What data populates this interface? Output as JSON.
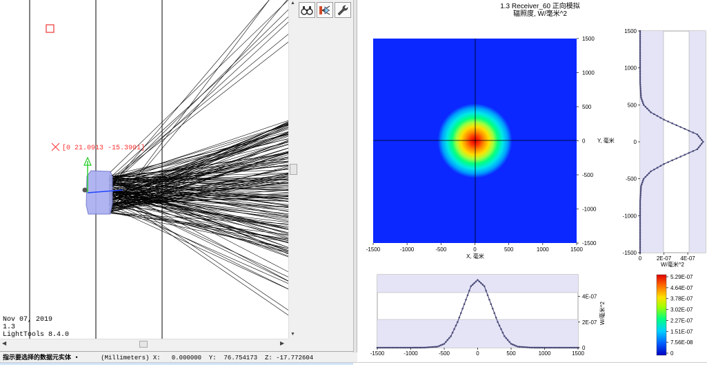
{
  "viewport": {
    "date": "Nov 07, 2019",
    "version": "1.3",
    "app": "LightTools 8.4.0",
    "coord_label": "[0 21.0913 -15.3901]"
  },
  "toolbar": {
    "buttons": [
      {
        "icon": "binoculars-icon"
      },
      {
        "icon": "ray-preview-icon"
      },
      {
        "icon": "wrench-icon"
      }
    ]
  },
  "statusbar": {
    "hint": "指示要选择的数据元实体",
    "units": "(Millimeters)",
    "x_label": "X:",
    "x": "0.000000",
    "y_label": "Y:",
    "y": "76.754173",
    "z_label": "Z:",
    "z": "-17.772604"
  },
  "colors": {
    "map_background": "#0a28ff",
    "ray": "#000000",
    "profile": "#4a4a78",
    "shade": "#e4e4f6"
  },
  "plot": {
    "title_line1": "1.3 Receiver_60 正向模拟",
    "title_line2": "辐照度, W/毫米^2",
    "x_axis_label": "X, 毫米",
    "y_axis_label": "Y, 毫米",
    "profile_h_ylabel": "W/毫米^2",
    "profile_v_xlabel": "W/毫米^2",
    "map_ticks": [
      "-1500",
      "-1000",
      "-500",
      "0",
      "500",
      "1000",
      "1500"
    ],
    "profile_h_yticks": [
      "0",
      "2E-07",
      "4E-07"
    ],
    "profile_v_xticks": [
      "0",
      "2E-07",
      "4E-07"
    ],
    "colorbar_ticks": [
      "5.29E-07",
      "4.64E-07",
      "3.78E-07",
      "3.02E-07",
      "2.27E-07",
      "1.51E-07",
      "7.56E-08",
      "0"
    ]
  },
  "chart_data": [
    {
      "type": "heatmap",
      "title": "1.3 Receiver_60 正向模拟 辐照度, W/毫米^2",
      "xlabel": "X, 毫米",
      "ylabel": "Y, 毫米",
      "xlim": [
        -1500,
        1500
      ],
      "ylim": [
        -1500,
        1500
      ],
      "peak": 5.29e-07,
      "peak_position": [
        0,
        0
      ],
      "spot_radius": 550,
      "colorbar": [
        0,
        7.56e-08,
        1.51e-07,
        2.27e-07,
        3.02e-07,
        3.78e-07,
        4.64e-07,
        5.29e-07
      ]
    },
    {
      "type": "line",
      "xlabel": "",
      "ylabel": "W/毫米^2",
      "xlim": [
        -1500,
        1500
      ],
      "ylim": [
        0,
        5.7e-07
      ],
      "x": [
        -1500,
        -1000,
        -800,
        -600,
        -500,
        -400,
        -300,
        -200,
        -100,
        0,
        100,
        200,
        300,
        400,
        500,
        600,
        800,
        1000,
        1500
      ],
      "series": [
        {
          "values": [
            0,
            0,
            4e-10,
            8e-09,
            3e-08,
            9e-08,
            2e-07,
            3.4e-07,
            4.8e-07,
            5.29e-07,
            4.8e-07,
            3.4e-07,
            2e-07,
            9e-08,
            3e-08,
            8e-09,
            4e-10,
            0,
            0
          ]
        }
      ]
    },
    {
      "type": "line",
      "xlabel": "W/毫米^2",
      "ylabel": "",
      "xlim": [
        0,
        5.5e-07
      ],
      "ylim": [
        -1500,
        1500
      ],
      "x": [
        -1500,
        -1000,
        -800,
        -600,
        -500,
        -400,
        -300,
        -200,
        -100,
        0,
        100,
        200,
        300,
        400,
        500,
        600,
        800,
        1000,
        1500
      ],
      "series": [
        {
          "values": [
            0,
            0,
            4e-10,
            8e-09,
            3e-08,
            9e-08,
            2e-07,
            3.4e-07,
            4.8e-07,
            5.29e-07,
            4.8e-07,
            3.4e-07,
            2e-07,
            9e-08,
            3e-08,
            8e-09,
            4e-10,
            0,
            0
          ]
        }
      ]
    }
  ]
}
